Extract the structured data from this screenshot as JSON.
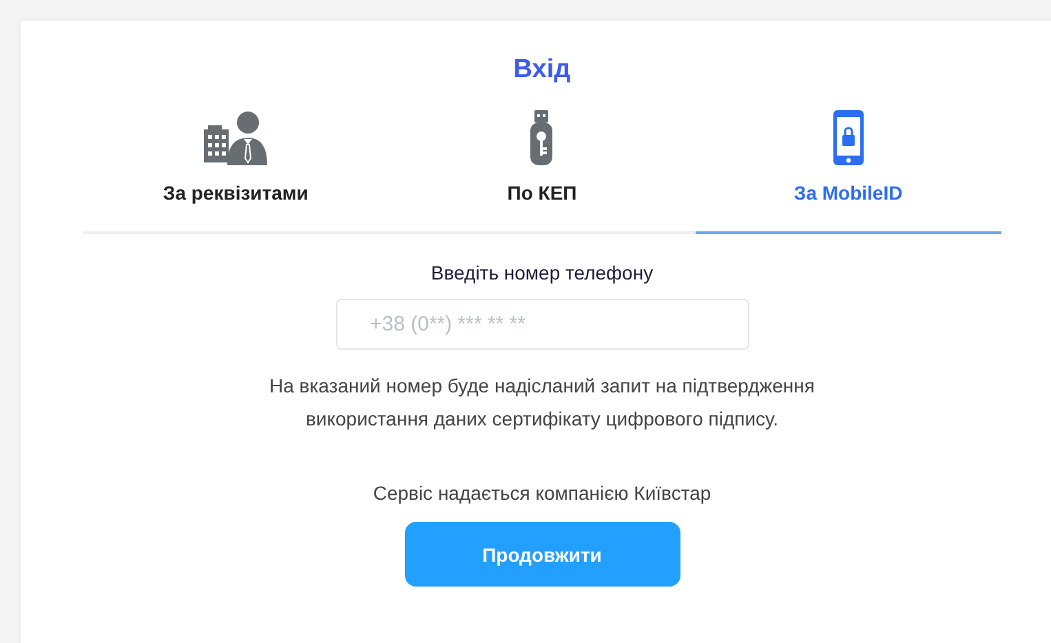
{
  "title": "Вхід",
  "tabs": [
    {
      "label": "За реквізитами",
      "kind": "company",
      "selected": false
    },
    {
      "label": "По КЕП",
      "kind": "usb-key",
      "selected": false
    },
    {
      "label": "За MobileID",
      "kind": "phone-lock",
      "selected": true
    }
  ],
  "form": {
    "label": "Введіть номер телефону",
    "phone": {
      "placeholder": "+38 (0**) *** ** **"
    },
    "note": "На вказаний номер буде надісланий запит на підтвердження використання даних сертифікату цифрового підпису.",
    "provider": "Сервіс надається компанією Київстар",
    "button": "Продовжити"
  }
}
